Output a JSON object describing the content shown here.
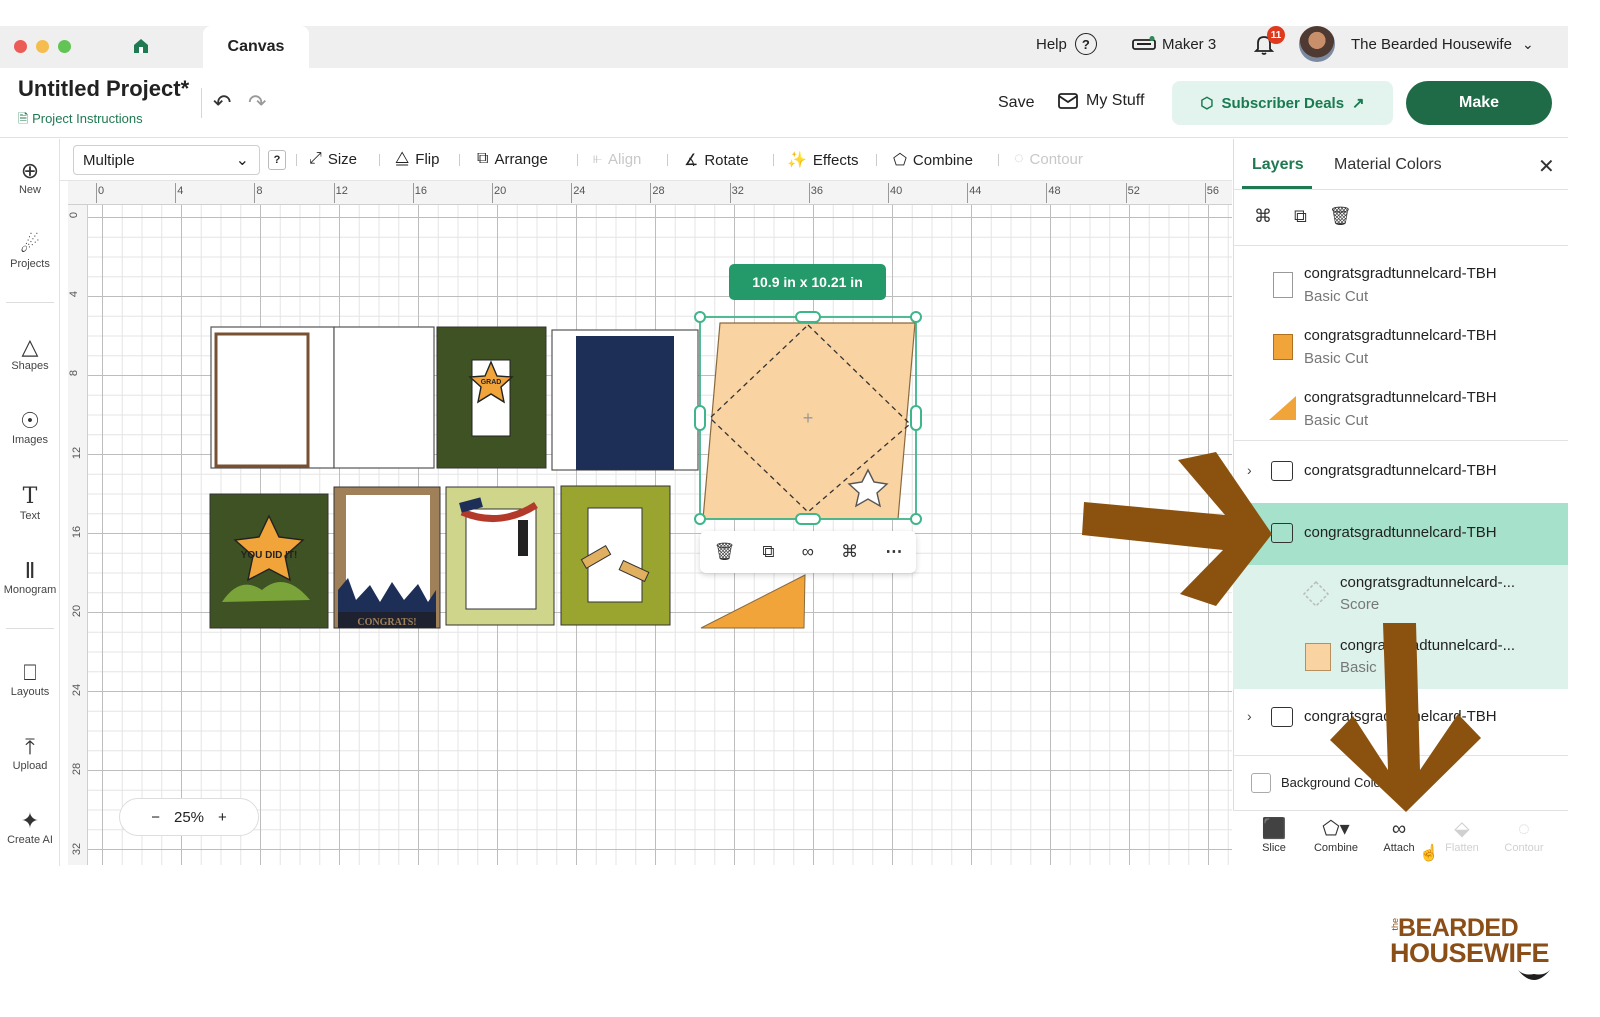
{
  "titlebar": {
    "tab_label": "Canvas",
    "help_label": "Help",
    "machine_label": "Maker 3",
    "notification_count": "11",
    "user_name": "The Bearded Housewife"
  },
  "header": {
    "project_title": "Untitled Project*",
    "project_instructions": "Project Instructions",
    "save_label": "Save",
    "mystuff_label": "My Stuff",
    "subscriber_label": "Subscriber Deals",
    "make_label": "Make"
  },
  "leftnav": {
    "items": [
      {
        "label": "New",
        "icon": "plus-circle-icon"
      },
      {
        "label": "Projects",
        "icon": "rocket-icon"
      },
      {
        "label": "Shapes",
        "icon": "shapes-icon"
      },
      {
        "label": "Images",
        "icon": "lightbulb-icon"
      },
      {
        "label": "Text",
        "icon": "text-icon"
      },
      {
        "label": "Monogram",
        "icon": "monogram-icon"
      },
      {
        "label": "Layouts",
        "icon": "shirt-icon"
      },
      {
        "label": "Upload",
        "icon": "upload-icon"
      },
      {
        "label": "Create AI",
        "icon": "sparkle-icon"
      }
    ]
  },
  "toolbar": {
    "select_value": "Multiple",
    "help_q": "?",
    "size": "Size",
    "flip": "Flip",
    "arrange": "Arrange",
    "align": "Align",
    "rotate": "Rotate",
    "effects": "Effects",
    "combine": "Combine",
    "contour": "Contour"
  },
  "canvas": {
    "h_ticks": [
      "0",
      "4",
      "8",
      "12",
      "16",
      "20",
      "24",
      "28",
      "32",
      "36",
      "40",
      "44",
      "48",
      "52",
      "56"
    ],
    "v_ticks": [
      "0",
      "4",
      "8",
      "12",
      "16",
      "20",
      "24",
      "28",
      "32"
    ],
    "zoom_minus": "−",
    "zoom_value": "25%",
    "zoom_plus": "+",
    "dimension_tag": "10.9  in x 10.21  in",
    "card_text_grad": "GRAD",
    "card_text_youdidit": "YOU DID IT!",
    "card_text_congrats": "CONGRATS!"
  },
  "panel": {
    "tab_layers": "Layers",
    "tab_material": "Material Colors",
    "layers": [
      {
        "name": "congratsgradtunnelcard-TBH",
        "sub": "Basic Cut"
      },
      {
        "name": "congratsgradtunnelcard-TBH",
        "sub": "Basic Cut"
      },
      {
        "name": "congratsgradtunnelcard-TBH",
        "sub": "Basic Cut"
      },
      {
        "name": "congratsgradtunnelcard-TBH"
      },
      {
        "name": "congratsgradtunnelcard-TBH"
      },
      {
        "name": "congratsgradtunnelcard-...",
        "sub": "Score"
      },
      {
        "name": "congratsgradtunnelcard-...",
        "sub": "Basic"
      },
      {
        "name": "congratsgradtunnelcard-TBH"
      }
    ],
    "background_label": "Background Color",
    "bottom": [
      {
        "label": "Slice"
      },
      {
        "label": "Combine"
      },
      {
        "label": "Attach"
      },
      {
        "label": "Flatten"
      },
      {
        "label": "Contour"
      }
    ]
  },
  "logo": {
    "the": "the",
    "line1": "BEARDED",
    "line2": "HOUSEWIFE"
  },
  "colors": {
    "brand_green": "#1f6b47",
    "selection_green": "#a6e1cb",
    "arrow_brown": "#8a520e"
  }
}
